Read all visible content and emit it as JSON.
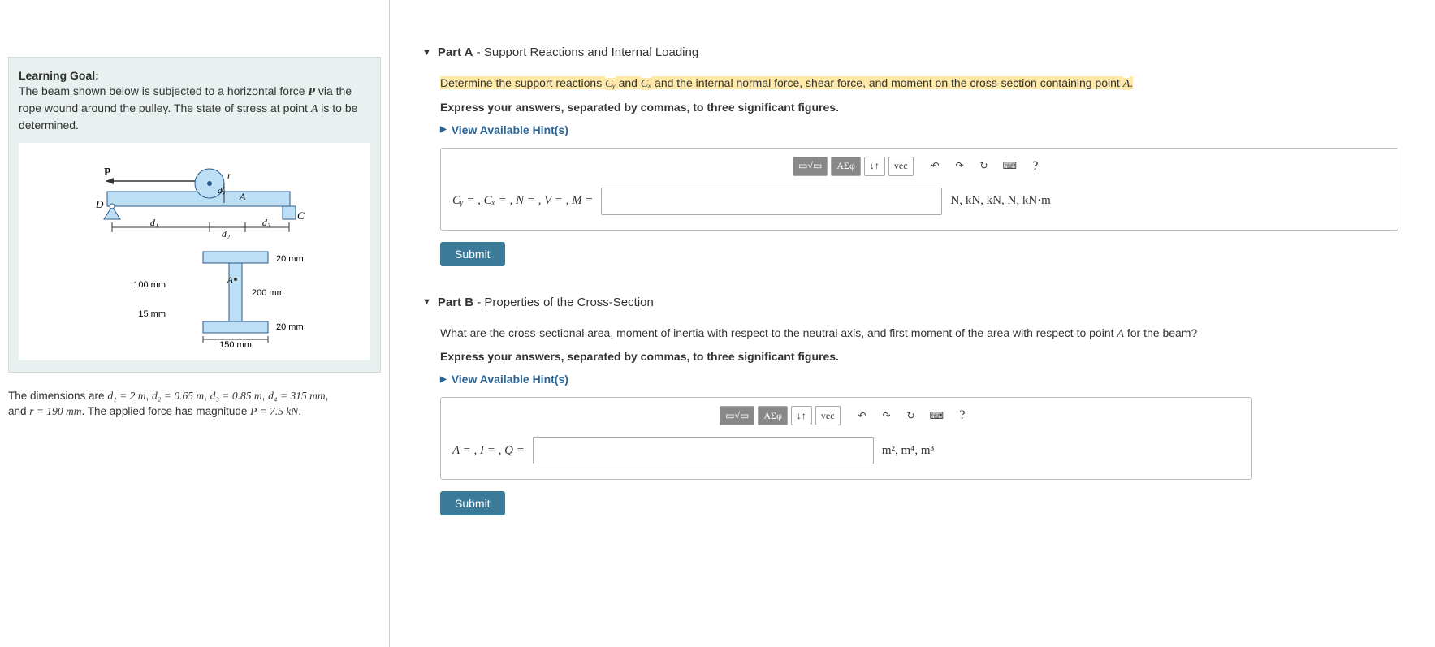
{
  "left": {
    "goal_title": "Learning Goal:",
    "goal_text_pre": "The beam shown below is subjected to a horizontal force ",
    "goal_text_mid": " via the rope wound around the pulley. The state of stress at point ",
    "goal_text_post": " is to be determined.",
    "P": "P",
    "A": "A",
    "fig": {
      "P": "P",
      "D": "D",
      "C": "C",
      "A": "A",
      "r": "r",
      "d1": "d₁",
      "d2": "d₂",
      "d3": "d₃",
      "d4": "d₄",
      "t20a": "20 mm",
      "t100": "100 mm",
      "t200": "200 mm",
      "t15": "15 mm",
      "t20b": "20 mm",
      "t150": "150 mm"
    },
    "dim_pre": "The dimensions are ",
    "d1eq": "d₁ = 2 m",
    "d2eq": "d₂ = 0.65 m",
    "d3eq": "d₃ = 0.85 m",
    "d4eq": "d₄ = 315 mm",
    "and_r": "r = 190 mm",
    "dim_mid": ". The applied force has magnitude ",
    "Peq": "P = 7.5 kN",
    "dim_end": "."
  },
  "partA": {
    "label": "Part A",
    "subtitle": " - Support Reactions and Internal Loading",
    "q_pre": "Determine the support reactions ",
    "Cy": "Cᵧ",
    "q_and": " and ",
    "Cx": "Cₓ",
    "q_post": " and the internal normal force, shear force, and moment on the cross-section containing point ",
    "A": "A",
    "q_end": ".",
    "instruct": "Express your answers, separated by commas, to three significant figures.",
    "hints": "View Available Hint(s)",
    "lhs": "Cᵧ = , Cₓ = , N = , V = , M =",
    "rhs": "N, kN, kN, N, kN·m",
    "submit": "Submit"
  },
  "partB": {
    "label": "Part B",
    "subtitle": " - Properties of the Cross-Section",
    "q_pre": "What are the cross-sectional area, moment of inertia with respect to the neutral axis, and first moment of the area with respect to point ",
    "A": "A",
    "q_post": " for the beam?",
    "instruct": "Express your answers, separated by commas, to three significant figures.",
    "hints": "View Available Hint(s)",
    "lhs": "A = , I = , Q =",
    "rhs": "m², m⁴, m³",
    "submit": "Submit"
  },
  "toolbar": {
    "templates": "▭√▭",
    "greek": "ΑΣφ",
    "subscript": "↓↑",
    "vec": "vec",
    "undo": "↶",
    "redo": "↷",
    "reset": "↻",
    "keyboard": "⌨",
    "help": "?"
  }
}
